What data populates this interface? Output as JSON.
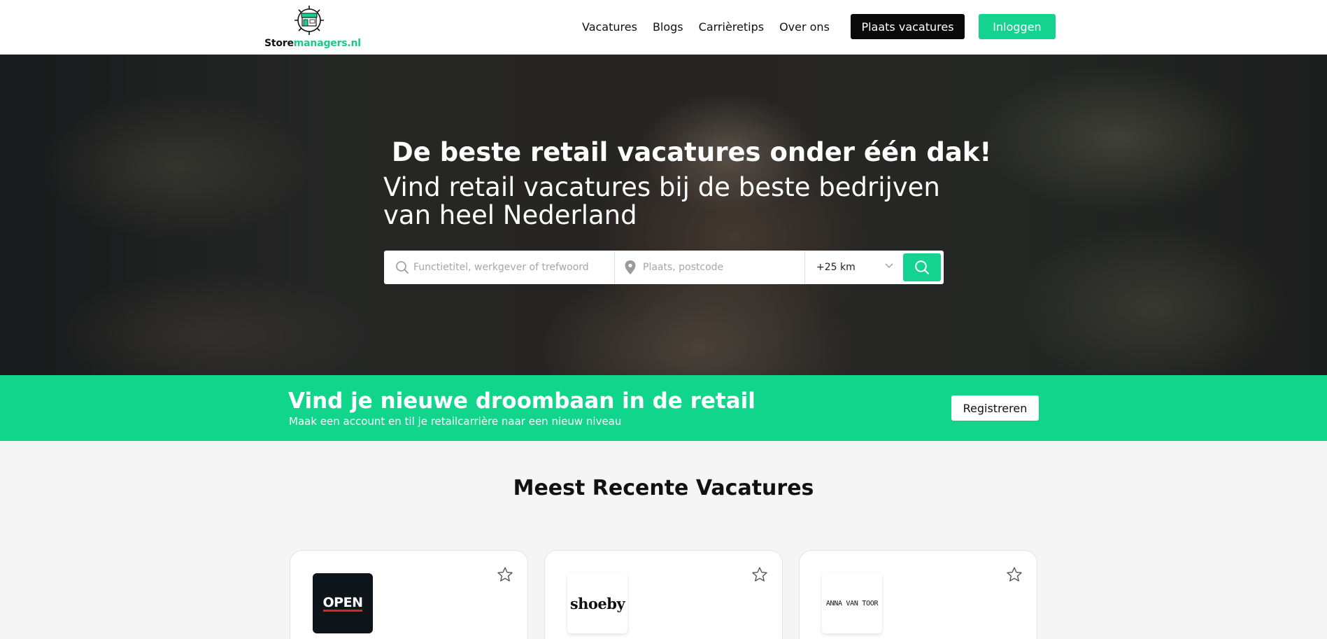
{
  "header": {
    "logo": {
      "text_main": "Store",
      "text_accent": "managers.nl",
      "icon": "storefront-gear-icon"
    },
    "nav": [
      {
        "label": "Vacatures"
      },
      {
        "label": "Blogs"
      },
      {
        "label": "Carrièretips"
      },
      {
        "label": "Over ons"
      }
    ],
    "post_jobs_label": "Plaats vacatures",
    "login_label": "Inloggen"
  },
  "hero": {
    "title": "De beste retail vacatures onder één dak!",
    "subtitle": "Vind retail vacatures bij de beste bedrijven van heel Nederland",
    "search": {
      "keyword_placeholder": "Functietitel, werkgever of trefwoord",
      "location_placeholder": "Plaats, postcode",
      "radius_value": "+25 km",
      "keyword_icon": "search-icon",
      "location_icon": "map-pin-icon",
      "radius_icon": "chevron-down-icon",
      "submit_icon": "search-icon"
    }
  },
  "banner": {
    "title": "Vind je nieuwe droombaan in de retail",
    "subtitle": "Maak een account en til je retailcarrière naar een nieuw niveau",
    "register_label": "Registreren"
  },
  "recent": {
    "title": "Meest Recente Vacatures",
    "cards": [
      {
        "company_logo_text": "OPEN",
        "favorite_icon": "star-icon"
      },
      {
        "company_logo_text": "shoeby",
        "favorite_icon": "star-icon"
      },
      {
        "company_logo_text": "ANNA VAN TOOR",
        "favorite_icon": "star-icon"
      }
    ]
  },
  "colors": {
    "brand_green": "#14d28f",
    "dark_button": "#0a0a0a"
  }
}
